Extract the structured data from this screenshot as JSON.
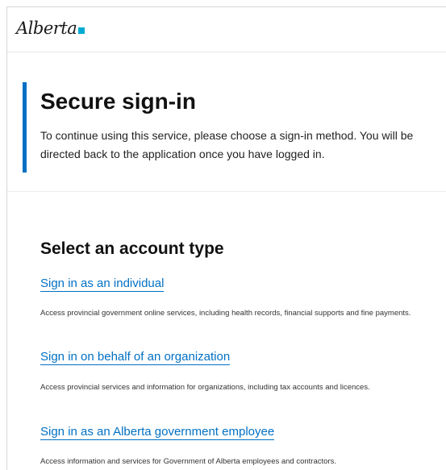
{
  "header": {
    "logo_text": "Alberta",
    "logo_accent_color": "#00aad2"
  },
  "hero": {
    "title": "Secure sign-in",
    "description": "To continue using this service, please choose a sign-in method. You will be directed back to the application once you have logged in.",
    "accent_color": "#0070c4"
  },
  "account_section": {
    "title": "Select an account type",
    "options": [
      {
        "label": "Sign in as an individual",
        "description": "Access provincial government online services, including health records, financial supports and fine payments."
      },
      {
        "label": "Sign in on behalf of an organization",
        "description": "Access provincial services and information for organizations, including tax accounts and licences."
      },
      {
        "label": "Sign in as an Alberta government employee",
        "description": "Access information and services for Government of Alberta employees and contractors."
      }
    ],
    "link_color": "#0070c4"
  }
}
